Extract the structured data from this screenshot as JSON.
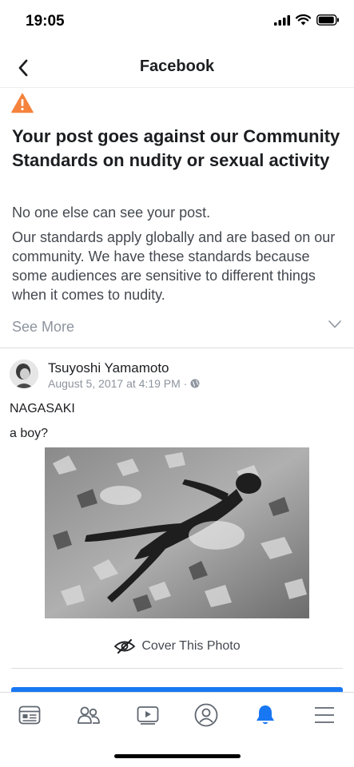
{
  "status_bar": {
    "time": "19:05"
  },
  "nav": {
    "title": "Facebook"
  },
  "notice": {
    "headline": "Your post goes against our Community Standards on nudity or sexual activity",
    "visibility_note": "No one else can see your post.",
    "standards_text": "Our standards apply globally and are based on our community. We have these standards because some audiences are sensitive to different things when it comes to nudity.",
    "see_more": "See More"
  },
  "post": {
    "author": "Tsuyoshi Yamamoto",
    "timestamp": "August 5, 2017 at 4:19 PM ·",
    "line1": "NAGASAKI",
    "line2": "a boy?",
    "cover_label": "Cover This Photo"
  },
  "tab_bar": {
    "tabs": [
      {
        "icon": "news-feed-icon"
      },
      {
        "icon": "friends-icon"
      },
      {
        "icon": "watch-icon"
      },
      {
        "icon": "profile-icon"
      },
      {
        "icon": "notifications-icon"
      },
      {
        "icon": "menu-icon"
      }
    ],
    "active_index": 4
  },
  "colors": {
    "accent": "#1877f2",
    "warning": "#f5833d",
    "text_primary": "#1c1e21",
    "text_secondary": "#444950",
    "text_muted": "#8d949e"
  }
}
